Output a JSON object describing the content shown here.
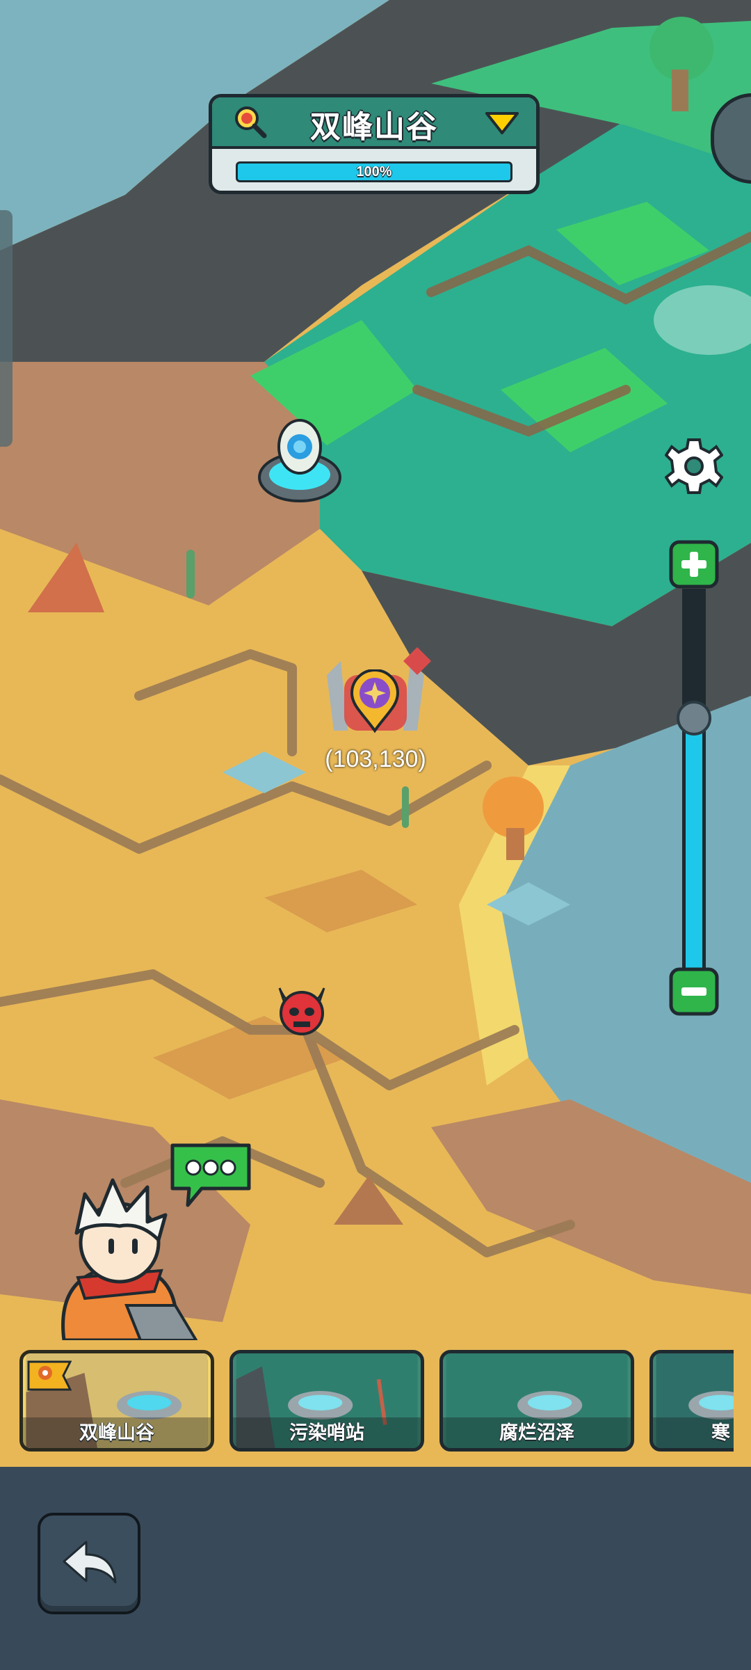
{
  "region": {
    "title": "双峰山谷",
    "progress_percent": 100,
    "progress_label": "100%"
  },
  "map": {
    "coordinates_label": "(103,130)",
    "icons": [
      "portal-icon",
      "castle-location-pin-icon",
      "enemy-demon-icon",
      "hero-avatar",
      "chat-bubble-icon"
    ]
  },
  "zoom": {
    "level_fraction": 0.34
  },
  "levels": [
    {
      "name": "双峰山谷",
      "current": true
    },
    {
      "name": "污染哨站",
      "current": false
    },
    {
      "name": "腐烂沼泽",
      "current": false
    },
    {
      "name": "寒",
      "current": false
    }
  ],
  "buttons": {
    "settings": "gear-icon",
    "zoom_in": "plus-icon",
    "zoom_out": "minus-icon",
    "back": "back-arrow-icon"
  },
  "colors": {
    "accent_cyan": "#1ec8ea",
    "green_button": "#2fb54a",
    "sand": "#e8b857",
    "water": "#78aebb",
    "grass": "#2fb08c"
  }
}
